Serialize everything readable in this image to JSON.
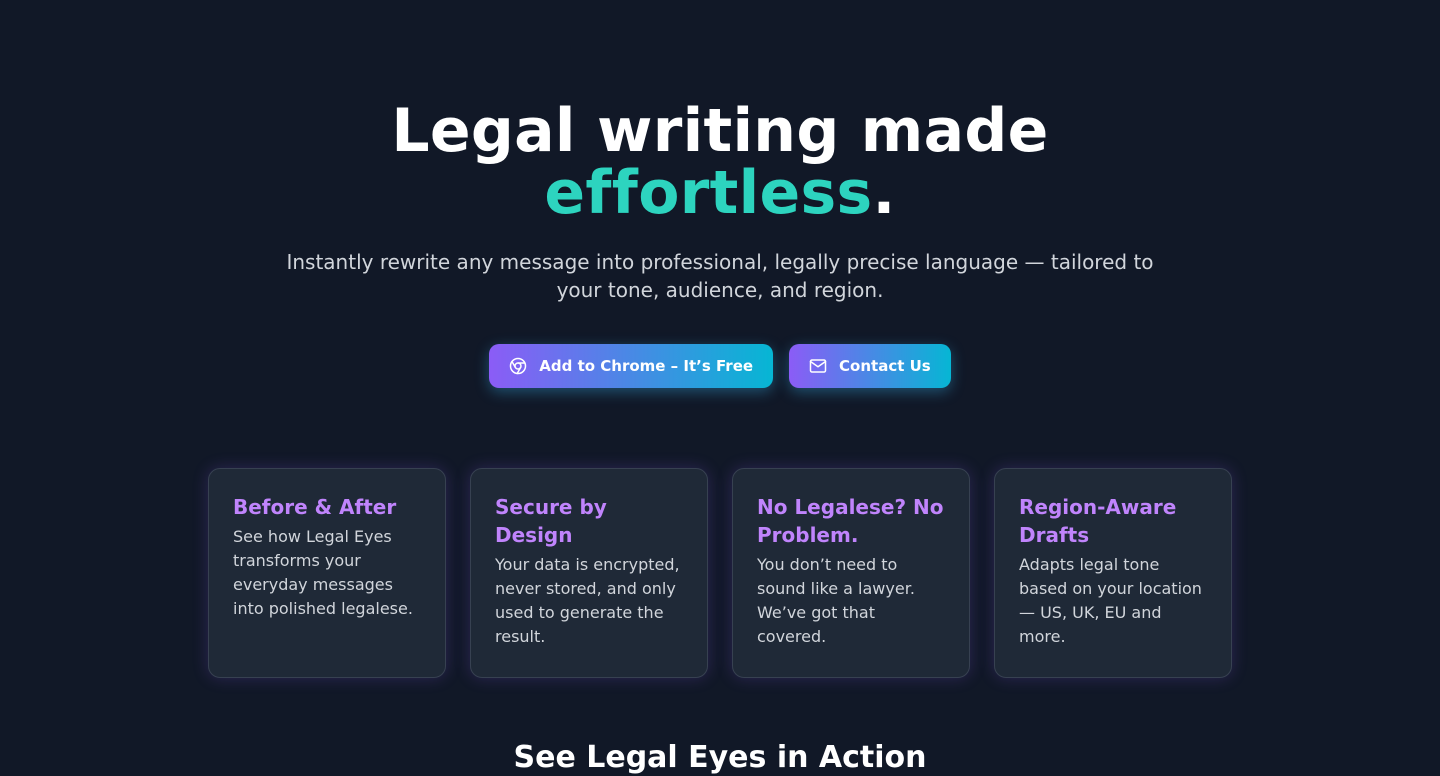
{
  "hero": {
    "headline_part1": "Legal writing made",
    "headline_accent": "effortless",
    "headline_end": ".",
    "subtitle": "Instantly rewrite any message into professional, legally precise language — tailored to your tone, audience, and region."
  },
  "buttons": {
    "chrome_label": "Add to Chrome – It’s Free",
    "chrome_icon": "chrome-icon",
    "contact_label": "Contact Us",
    "contact_icon": "mail-icon"
  },
  "features": [
    {
      "title": "Before & After",
      "text": "See how Legal Eyes transforms your everyday messages into polished legalese."
    },
    {
      "title": "Secure by Design",
      "text": "Your data is encrypted, never stored, and only used to generate the result."
    },
    {
      "title": "No Legalese? No Problem.",
      "text": "You don’t need to sound like a lawyer. We’ve got that covered."
    },
    {
      "title": "Region-Aware Drafts",
      "text": "Adapts legal tone based on your location — US, UK, EU and more."
    }
  ],
  "section": {
    "title": "See Legal Eyes in Action"
  },
  "colors": {
    "background": "#111827",
    "accent": "#2dd4bf",
    "card_title": "#c084fc",
    "gradient_start": "#8b5cf6",
    "gradient_end": "#06b6d4"
  }
}
